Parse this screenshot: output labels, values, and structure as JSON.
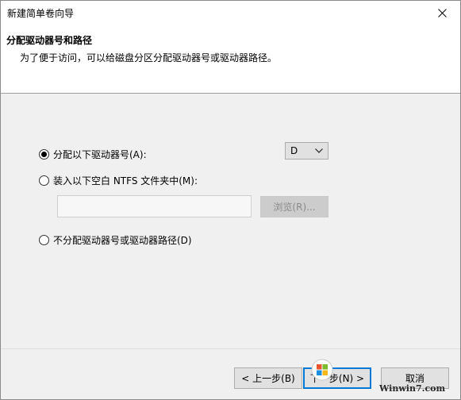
{
  "window": {
    "title": "新建简单卷向导"
  },
  "header": {
    "title": "分配驱动器号和路径",
    "subtitle": "为了便于访问，可以给磁盘分区分配驱动器号或驱动器路径。"
  },
  "options": {
    "assign_letter": {
      "label": "分配以下驱动器号(A):",
      "checked": true
    },
    "mount_folder": {
      "label": "装入以下空白 NTFS 文件夹中(M):",
      "checked": false
    },
    "no_assign": {
      "label": "不分配驱动器号或驱动器路径(D)",
      "checked": false
    }
  },
  "drive_letter": {
    "selected": "D"
  },
  "folder_path": {
    "value": ""
  },
  "browse": {
    "label": "浏览(R)...",
    "disabled": true
  },
  "footer": {
    "back_label": "< 上一步(B)",
    "next_label": "下一步(N) >",
    "cancel_label": "取消"
  },
  "watermark": {
    "site": "Winwin7.com"
  },
  "colors": {
    "focus_border": "#0078d7",
    "header_bg": "#ffffff",
    "body_bg": "#f0f0f0"
  }
}
